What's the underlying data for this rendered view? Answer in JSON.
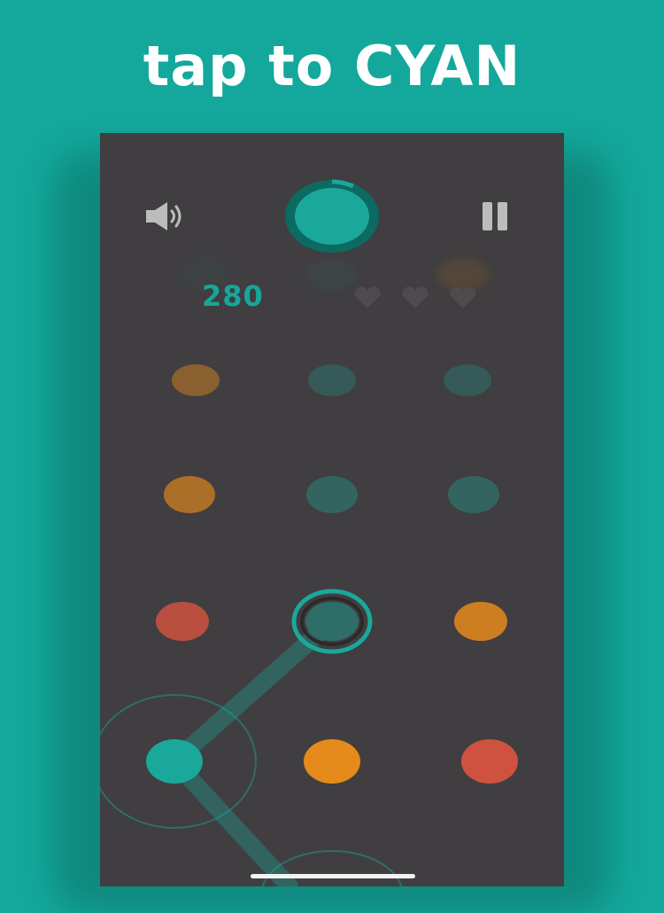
{
  "headline": "tap to CYAN",
  "hud": {
    "score": "280",
    "target_color": "#1aa89b",
    "sound_icon": "speaker-icon",
    "pause_icon": "pause-icon",
    "lives_remaining": 0,
    "lives_total": 3
  },
  "colors": {
    "background": "#13a89b",
    "board": "#403e40",
    "cyan": "#1aa89b",
    "orange": "#e68a1c",
    "red": "#cf5240"
  },
  "board": {
    "rows": [
      [
        "orange",
        "cyan",
        "cyan"
      ],
      [
        "orange",
        "cyan",
        "cyan"
      ],
      [
        "red",
        "cyan",
        "orange"
      ],
      [
        "cyan",
        "orange",
        "red"
      ]
    ],
    "selected": {
      "row": 2,
      "col": 1
    },
    "current": {
      "row": 3,
      "col": 0
    }
  }
}
